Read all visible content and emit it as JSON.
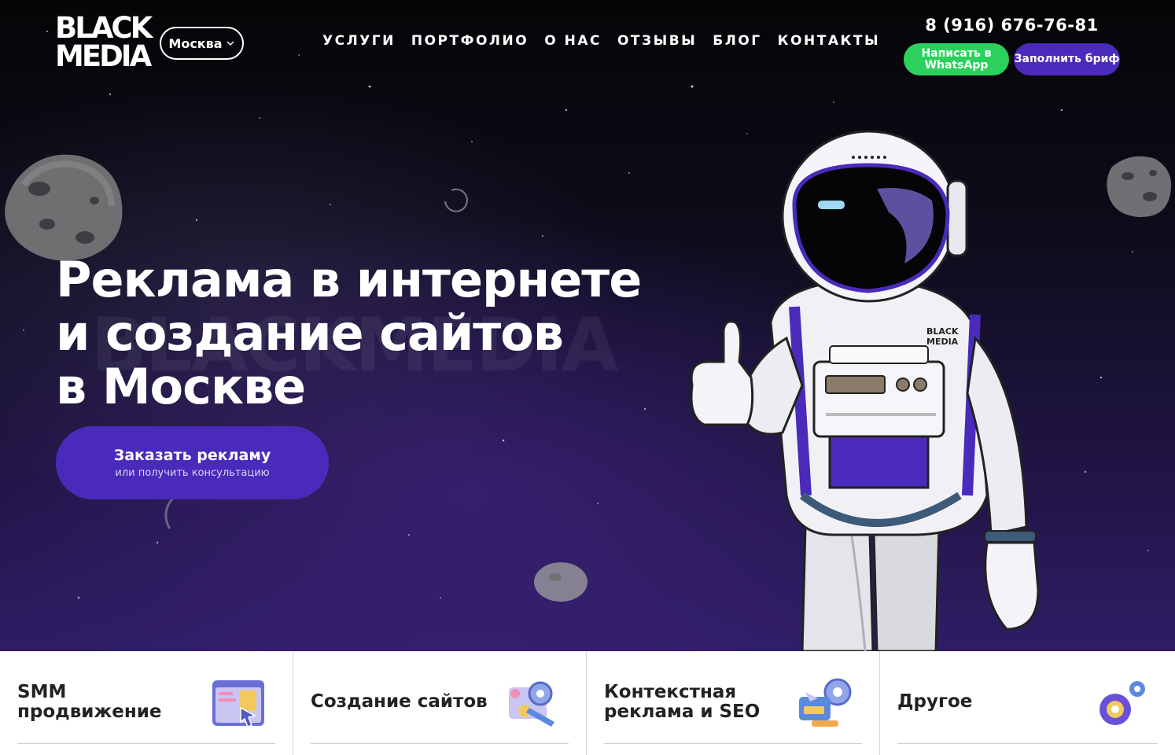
{
  "header": {
    "logo": [
      "BLACK",
      "MEDIA"
    ],
    "city": "Москва",
    "nav": [
      "УСЛУГИ",
      "ПОРТФОЛИО",
      "О НАС",
      "ОТЗЫВЫ",
      "БЛОГ",
      "КОНТАКТЫ"
    ],
    "phone": "8 (916) 676-76-81",
    "whatsapp_label": "Написать в WhatsApp",
    "brief_label": "Заполнить бриф"
  },
  "hero": {
    "title_lines": [
      "Реклама в интернете",
      "и создание сайтов",
      "в Москве"
    ],
    "watermark": "BLACKMEDIA",
    "button_main": "Заказать рекламу",
    "button_sub": "или получить консультацию",
    "astronaut_badge": [
      "BLACK",
      "MEDIA"
    ]
  },
  "services": [
    {
      "title": "SMM продвижение",
      "icon": "browser-cursor-icon"
    },
    {
      "title": "Создание сайтов",
      "icon": "gear-wrench-icon"
    },
    {
      "title": "Контекстная реклама и SEO",
      "icon": "seo-gear-icon"
    },
    {
      "title": "Другое",
      "icon": "gears-icon"
    }
  ],
  "colors": {
    "accent": "#4a2aba",
    "whatsapp": "#2bd15c",
    "card_text": "#222222"
  }
}
